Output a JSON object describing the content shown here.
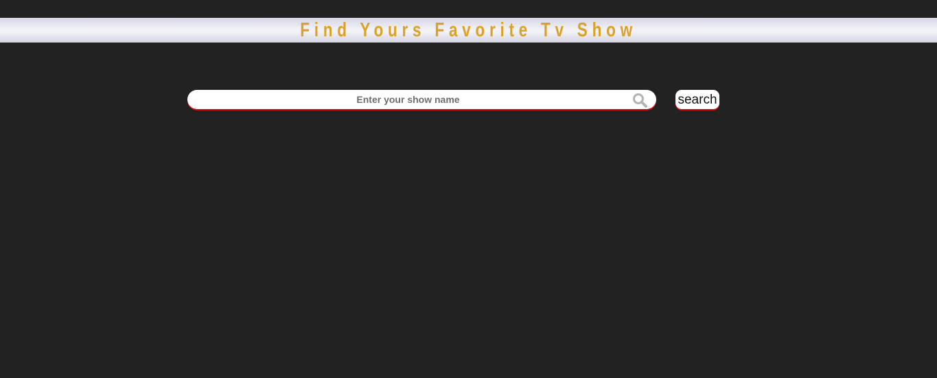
{
  "header": {
    "title": "Find Yours Favorite Tv Show"
  },
  "search": {
    "placeholder": "Enter your show name",
    "value": "",
    "icon": "search-icon",
    "button_label": "search"
  },
  "colors": {
    "background": "#222222",
    "title": "#dba22a",
    "accent_underline": "#d10a0a",
    "icon": "#b3b3b3"
  }
}
